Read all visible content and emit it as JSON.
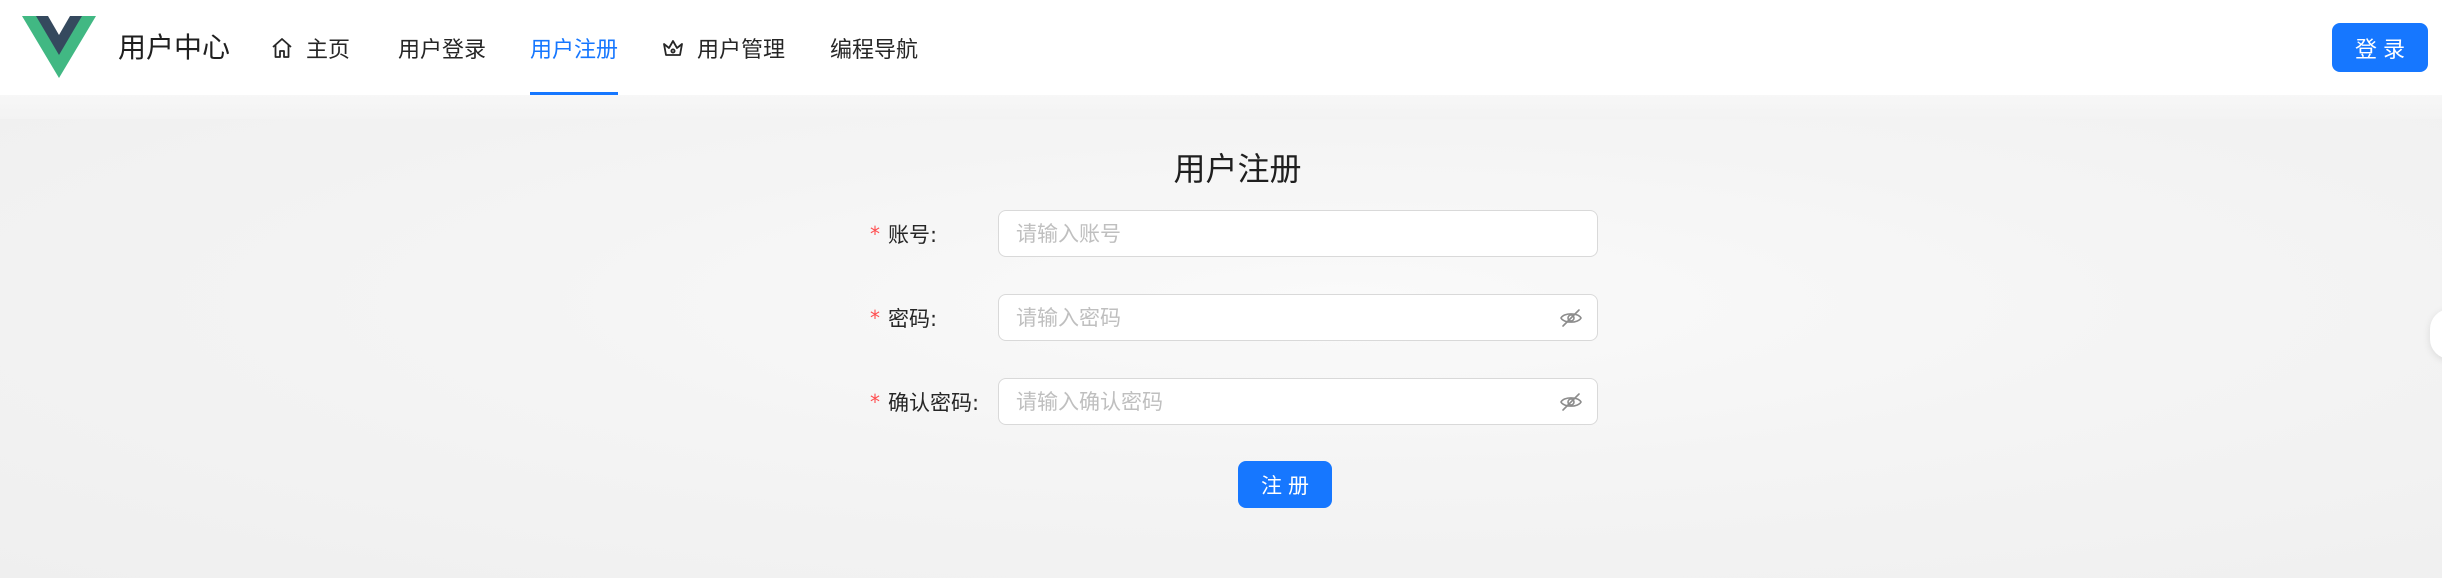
{
  "header": {
    "app_title": "用户中心",
    "logo_icon": "vue-logo-icon",
    "nav": [
      {
        "label": "主页",
        "icon": "home-icon",
        "active": false
      },
      {
        "label": "用户登录",
        "icon": "",
        "active": false
      },
      {
        "label": "用户注册",
        "icon": "",
        "active": true
      },
      {
        "label": "用户管理",
        "icon": "crown-icon",
        "active": false
      },
      {
        "label": "编程导航",
        "icon": "",
        "active": false
      }
    ],
    "login_button": "登录"
  },
  "form": {
    "title": "用户注册",
    "required_mark": "*",
    "fields": [
      {
        "label": "账号:",
        "placeholder": "请输入账号",
        "value": "",
        "type": "text"
      },
      {
        "label": "密码:",
        "placeholder": "请输入密码",
        "value": "",
        "type": "password",
        "icon": "eye-invisible-icon"
      },
      {
        "label": "确认密码:",
        "placeholder": "请输入确认密码",
        "value": "",
        "type": "password",
        "icon": "eye-invisible-icon"
      }
    ],
    "submit_button": "注册"
  },
  "colors": {
    "primary": "#1677ff",
    "required": "#ff4d4f",
    "logo_green": "#41b883",
    "logo_dark": "#35495e"
  }
}
